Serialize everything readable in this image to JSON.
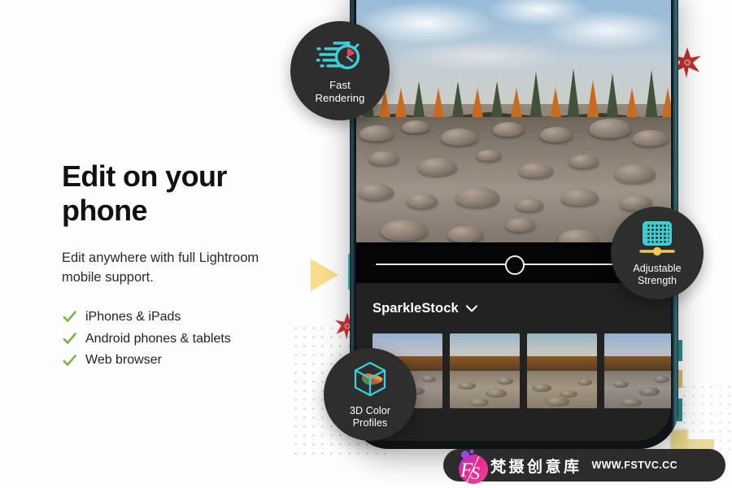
{
  "headline": "Edit on your\nphone",
  "subcopy": "Edit anywhere with full Lightroom mobile support.",
  "features": [
    {
      "label": "iPhones & iPads",
      "icon": "check-icon"
    },
    {
      "label": "Android phones & tablets",
      "icon": "check-icon"
    },
    {
      "label": "Web browser",
      "icon": "check-icon"
    }
  ],
  "badges": [
    {
      "label": "Fast\nRendering",
      "icon": "stopwatch-speed-icon"
    },
    {
      "label": "Adjustable\nStrength",
      "icon": "halftone-slider-icon"
    },
    {
      "label": "3D Color\nProfiles",
      "icon": "color-cube-icon"
    }
  ],
  "phone": {
    "slider": {
      "value": 50,
      "min": 0,
      "max": 100
    },
    "preset_panel": {
      "title": "SparkleStock",
      "chevron": "chevron-down-icon",
      "thumbnails": [
        {
          "name": "preset-thumb-1"
        },
        {
          "name": "preset-thumb-2"
        },
        {
          "name": "preset-thumb-3"
        },
        {
          "name": "preset-thumb-4"
        }
      ]
    },
    "hero_photo_alt": "Autumn forest river with rocks"
  },
  "watermark": {
    "logo_text": "FS",
    "brand_cn": "梵摄创意库",
    "url": "WWW.FSTVC.CC"
  },
  "colors": {
    "background": "#fdfdfd",
    "headline": "#111111",
    "check_green": "#6fb343",
    "badge_bg": "#2e2e2e",
    "accent_teal": "#3ec6cf",
    "accent_yellow": "#f2c94c",
    "accent_red": "#d2322d",
    "panel_dark": "#222222",
    "watermark_bg": "#2c2c2c",
    "logo_pink": "#e8268f"
  },
  "decorations": {
    "triangle": "yellow-triangle",
    "sparkles": [
      "red-sparkle-right",
      "red-sparkle-left"
    ],
    "dot_grids": [
      "dot-grid-left",
      "dot-grid-right"
    ]
  }
}
